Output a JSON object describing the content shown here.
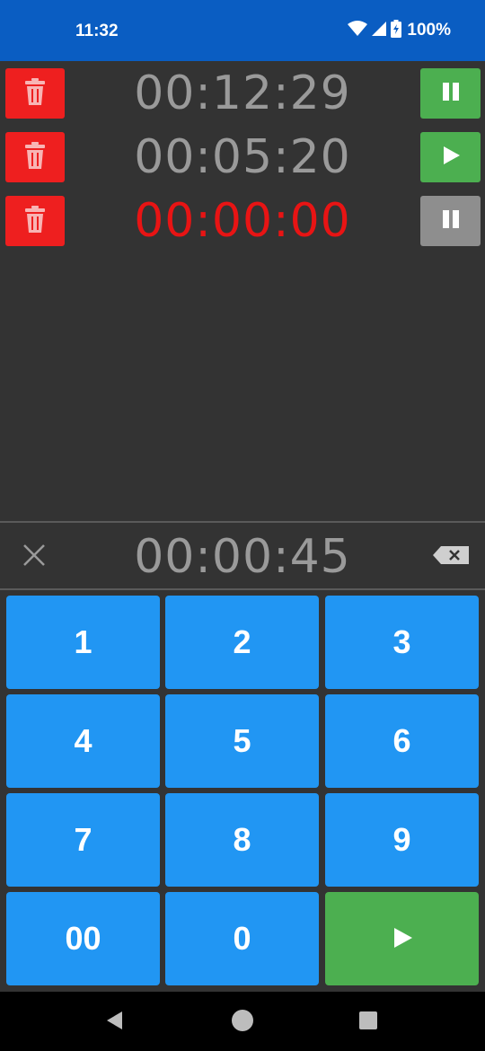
{
  "status_bar": {
    "time": "11:32",
    "battery": "100%"
  },
  "timers": [
    {
      "time": "00:12:29",
      "state": "running",
      "control": "pause"
    },
    {
      "time": "00:05:20",
      "state": "paused",
      "control": "play"
    },
    {
      "time": "00:00:00",
      "state": "expired",
      "control": "pause-disabled"
    }
  ],
  "input": {
    "time": "00:00:45"
  },
  "keypad": {
    "k1": "1",
    "k2": "2",
    "k3": "3",
    "k4": "4",
    "k5": "5",
    "k6": "6",
    "k7": "7",
    "k8": "8",
    "k9": "9",
    "k00": "00",
    "k0": "0"
  },
  "colors": {
    "status_bar": "#0a5dc2",
    "background": "#333333",
    "delete": "#ee1f1f",
    "play_pause": "#4caf50",
    "disabled": "#8e8e8e",
    "key": "#2196f3",
    "expired_time": "#e81414",
    "time_text": "#9a9a9a"
  }
}
